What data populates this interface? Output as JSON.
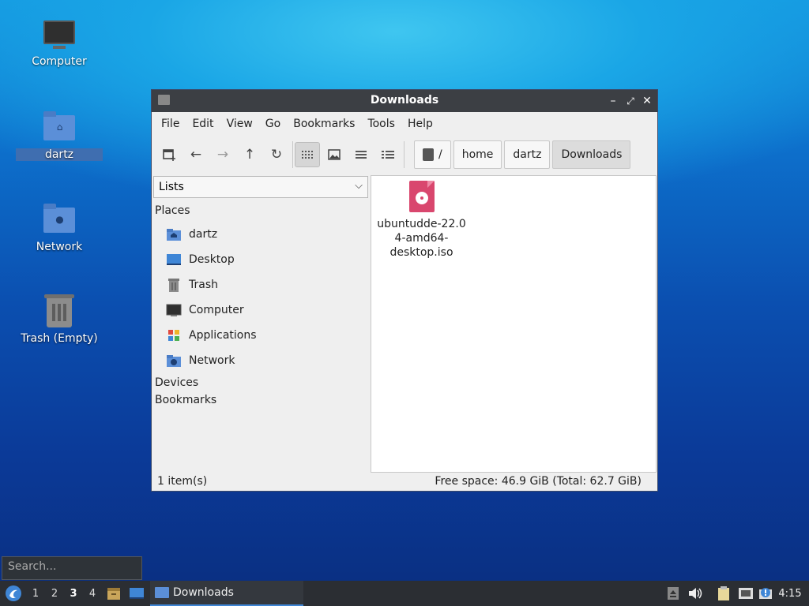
{
  "desktop": {
    "icons": [
      {
        "label": "Computer"
      },
      {
        "label": "dartz"
      },
      {
        "label": "Network"
      },
      {
        "label": "Trash (Empty)"
      }
    ]
  },
  "window": {
    "title": "Downloads",
    "controls": {
      "minimize": "–",
      "maximize": "⤢",
      "close": "✕"
    },
    "menu": [
      "File",
      "Edit",
      "View",
      "Go",
      "Bookmarks",
      "Tools",
      "Help"
    ],
    "path": {
      "root": "/",
      "crumbs": [
        "home",
        "dartz",
        "Downloads"
      ]
    },
    "sidebar": {
      "pane_selector": "Lists",
      "places_heading": "Places",
      "places": [
        {
          "label": "dartz",
          "icon": "home-folder-icon"
        },
        {
          "label": "Desktop",
          "icon": "desktop-icon"
        },
        {
          "label": "Trash",
          "icon": "trash-icon"
        },
        {
          "label": "Computer",
          "icon": "computer-icon"
        },
        {
          "label": "Applications",
          "icon": "applications-icon"
        },
        {
          "label": "Network",
          "icon": "network-folder-icon"
        }
      ],
      "devices_heading": "Devices",
      "bookmarks_heading": "Bookmarks"
    },
    "files": [
      {
        "name": "ubuntudde-22.04-amd64-desktop.iso",
        "name_lines": [
          "ubuntudde-22.0",
          "4-amd64-",
          "desktop.iso"
        ],
        "icon": "disc-image-icon"
      }
    ],
    "status": {
      "count": "1 item(s)",
      "space": "Free space: 46.9 GiB (Total: 62.7 GiB)"
    }
  },
  "search": {
    "placeholder": "Search..."
  },
  "taskbar": {
    "workspaces": [
      "1",
      "2",
      "3",
      "4"
    ],
    "active_workspace": "3",
    "window_item": "Downloads",
    "clock": "4:15"
  },
  "colors": {
    "accent": "#3f86d6",
    "folder": "#5b8fd8",
    "iso": "#d9476e",
    "titlebar": "#3c3f44"
  }
}
